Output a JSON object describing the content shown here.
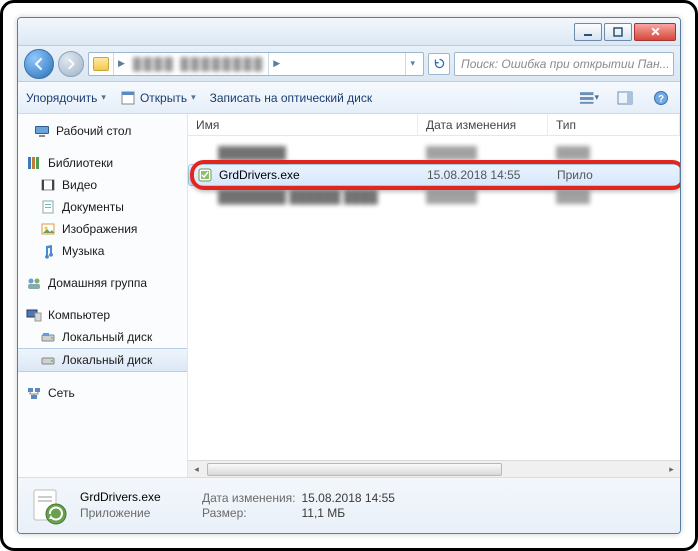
{
  "window_controls": {
    "min": "–",
    "max": "❐",
    "close": "✕"
  },
  "search": {
    "placeholder": "Поиск: Ошибка при открытии Пан..."
  },
  "toolbar": {
    "organize": "Упорядочить",
    "open": "Открыть",
    "burn": "Записать на оптический диск"
  },
  "sidebar": {
    "desktop": "Рабочий стол",
    "libraries": "Библиотеки",
    "video": "Видео",
    "documents": "Документы",
    "pictures": "Изображения",
    "music": "Музыка",
    "homegroup": "Домашняя группа",
    "computer": "Компьютер",
    "localdisk1": "Локальный диск",
    "localdisk2": "Локальный диск",
    "network": "Сеть"
  },
  "columns": {
    "name": "Имя",
    "date": "Дата изменения",
    "type": "Тип"
  },
  "file": {
    "name": "GrdDrivers.exe",
    "date": "15.08.2018 14:55",
    "type_short": "Прило",
    "type_full": "Приложение"
  },
  "details": {
    "mod_label": "Дата изменения:",
    "mod_value": "15.08.2018 14:55",
    "size_label": "Размер:",
    "size_value": "11,1 МБ"
  }
}
